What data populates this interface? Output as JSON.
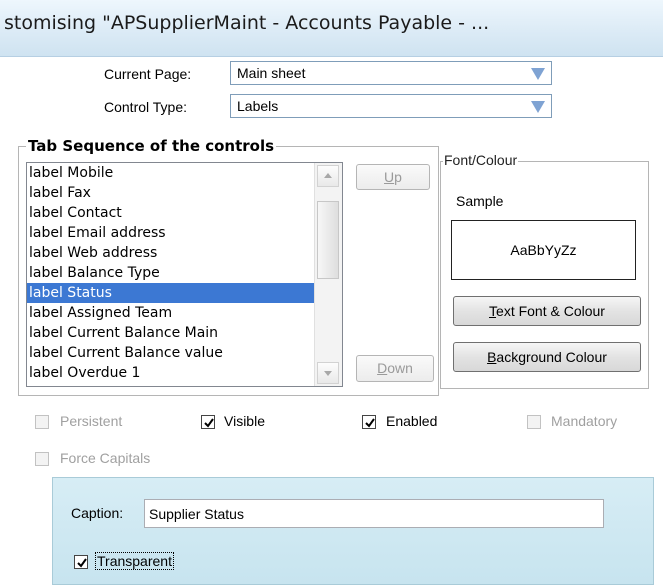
{
  "window": {
    "title": "stomising \"APSupplierMaint - Accounts Payable - ..."
  },
  "current_page": {
    "label": "Current Page:",
    "value": "Main sheet"
  },
  "control_type": {
    "label": "Control Type:",
    "value": "Labels"
  },
  "tab_sequence": {
    "title": "Tab Sequence of the controls",
    "items": [
      "label Mobile",
      "label Fax",
      "label Contact",
      "label Email address",
      "label Web address",
      "label Balance Type",
      "label Status",
      "label Assigned Team",
      "label Current Balance Main",
      "label Current Balance value",
      "label Overdue 1"
    ],
    "selected_index": 6,
    "up_first": "U",
    "up_rest": "p",
    "down_first": "D",
    "down_rest": "own"
  },
  "font_colour": {
    "title": "Font/Colour",
    "sample_label": "Sample",
    "sample_text": "AaBbYyZz",
    "text_font_first": "T",
    "text_font_rest": "ext Font & Colour",
    "background_first": "B",
    "background_rest": "ackground Colour"
  },
  "checkboxes": {
    "persistent": {
      "label": "Persistent",
      "checked": false,
      "enabled": false
    },
    "visible": {
      "label": "Visible",
      "checked": true,
      "enabled": true
    },
    "enabled": {
      "label": "Enabled",
      "checked": true,
      "enabled": true
    },
    "mandatory": {
      "label": "Mandatory",
      "checked": false,
      "enabled": false
    },
    "force_capitals": {
      "label": "Force Capitals",
      "checked": false,
      "enabled": false
    }
  },
  "caption": {
    "label": "Caption:",
    "value": "Supplier Status"
  },
  "transparent": {
    "label": "Transparent",
    "checked": true
  },
  "colors": {
    "selection": "#3c78d3",
    "combo_arrow": "#7fa3d3",
    "caption_panel": "#cfe8f2"
  },
  "icons": {
    "combo_arrow": "triangle-down-icon",
    "scroll_up": "scroll-up-arrow-icon",
    "scroll_down": "scroll-down-arrow-icon",
    "check": "checkmark-icon"
  }
}
